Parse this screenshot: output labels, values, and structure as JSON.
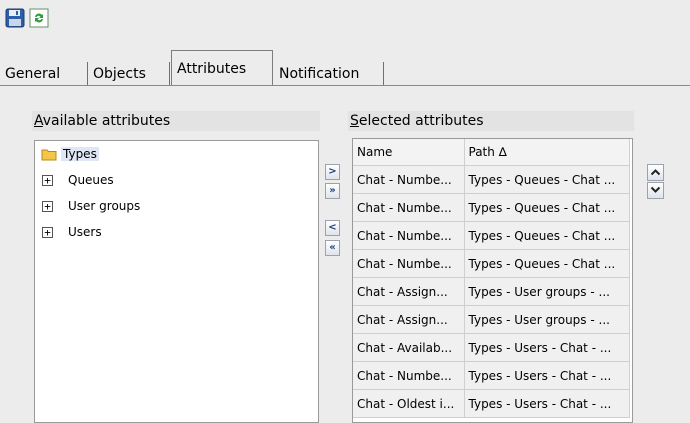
{
  "toolbar": {
    "save_icon": "floppy-save-icon",
    "refresh_icon": "refresh-icon"
  },
  "tabs": [
    {
      "label": "General",
      "active": false
    },
    {
      "label": "Objects",
      "active": false
    },
    {
      "label": "Attributes",
      "active": true
    },
    {
      "label": "Notification",
      "active": false
    }
  ],
  "available": {
    "label_accel": "A",
    "label_rest": "vailable attributes",
    "tree": {
      "root_label": "Types",
      "nodes": [
        {
          "label": "Queues"
        },
        {
          "label": "User groups"
        },
        {
          "label": "Users"
        }
      ]
    }
  },
  "transfer_buttons": {
    "add": ">",
    "add_all": "»",
    "remove": "<",
    "remove_all": "«"
  },
  "selected": {
    "label_accel": "S",
    "label_rest": "elected attributes",
    "columns": {
      "name": "Name",
      "path": "Path",
      "sort_indicator": "∆"
    },
    "rows": [
      {
        "name": "Chat - Numbe...",
        "path": "Types - Queues - Chat ..."
      },
      {
        "name": "Chat - Numbe...",
        "path": "Types - Queues - Chat ..."
      },
      {
        "name": "Chat - Numbe...",
        "path": "Types - Queues - Chat ..."
      },
      {
        "name": "Chat - Numbe...",
        "path": "Types - Queues - Chat ..."
      },
      {
        "name": "Chat - Assign...",
        "path": "Types - User groups - ..."
      },
      {
        "name": "Chat - Assign...",
        "path": "Types - User groups - ..."
      },
      {
        "name": "Chat - Availab...",
        "path": "Types - Users - Chat - ..."
      },
      {
        "name": "Chat - Numbe...",
        "path": "Types - Users - Chat - ..."
      },
      {
        "name": "Chat - Oldest i...",
        "path": "Types - Users - Chat - ..."
      }
    ]
  },
  "order_buttons": {
    "up_icon": "chevron-up-icon",
    "down_icon": "chevron-down-icon"
  },
  "colors": {
    "accent": "#1c3f7a",
    "background": "#ececec",
    "folder": "#f3c64a"
  }
}
